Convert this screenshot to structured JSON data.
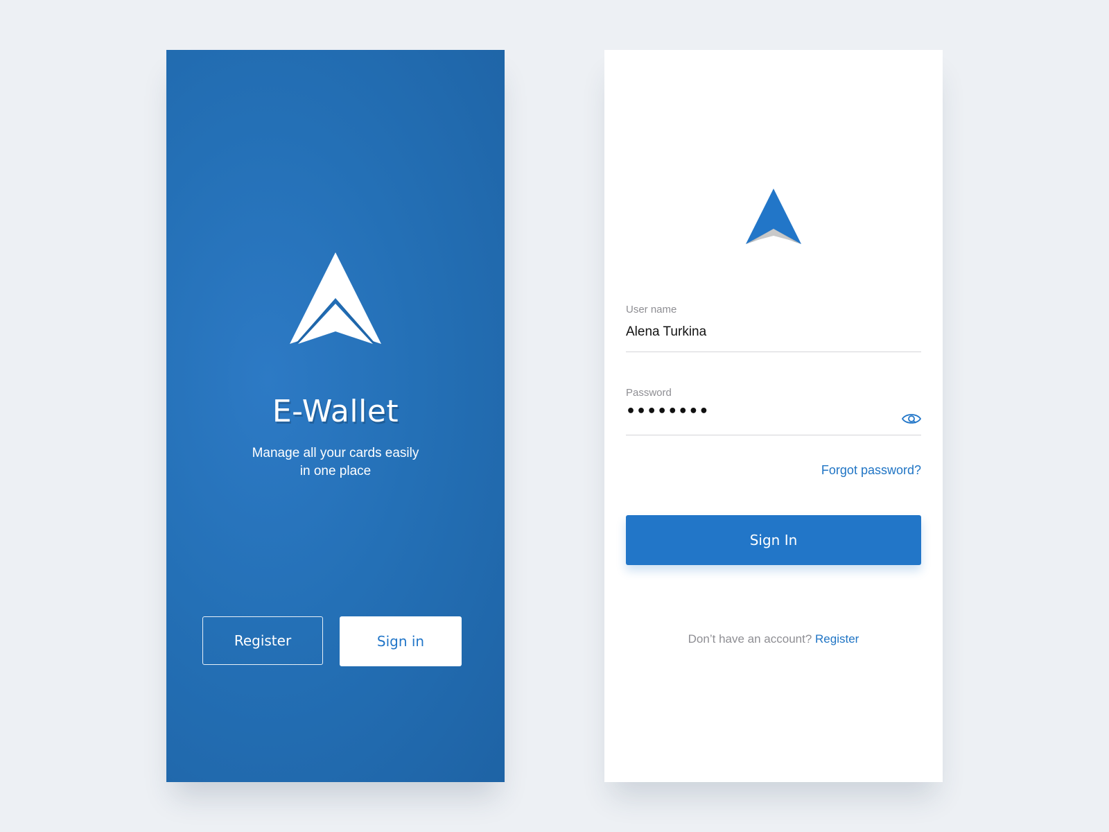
{
  "colors": {
    "brand_blue": "#2276c8",
    "link_blue": "#1f74c4",
    "background": "#edf0f4",
    "logo_gray": "#b9b9b9"
  },
  "splash": {
    "logo_icon": "arrow-up-logo",
    "title": "E-Wallet",
    "subtitle_line1": "Manage all your cards easily",
    "subtitle_line2": "in one place",
    "register_label": "Register",
    "signin_label": "Sign in"
  },
  "signin": {
    "logo_icon": "arrow-up-logo",
    "username": {
      "label": "User name",
      "value": "Alena Turkina"
    },
    "password": {
      "label": "Password",
      "masked_value": "••••••••",
      "toggle_icon": "eye-icon"
    },
    "forgot_label": "Forgot password?",
    "submit_label": "Sign In",
    "footer_prompt": "Don’t have an account?",
    "footer_link": "Register"
  }
}
